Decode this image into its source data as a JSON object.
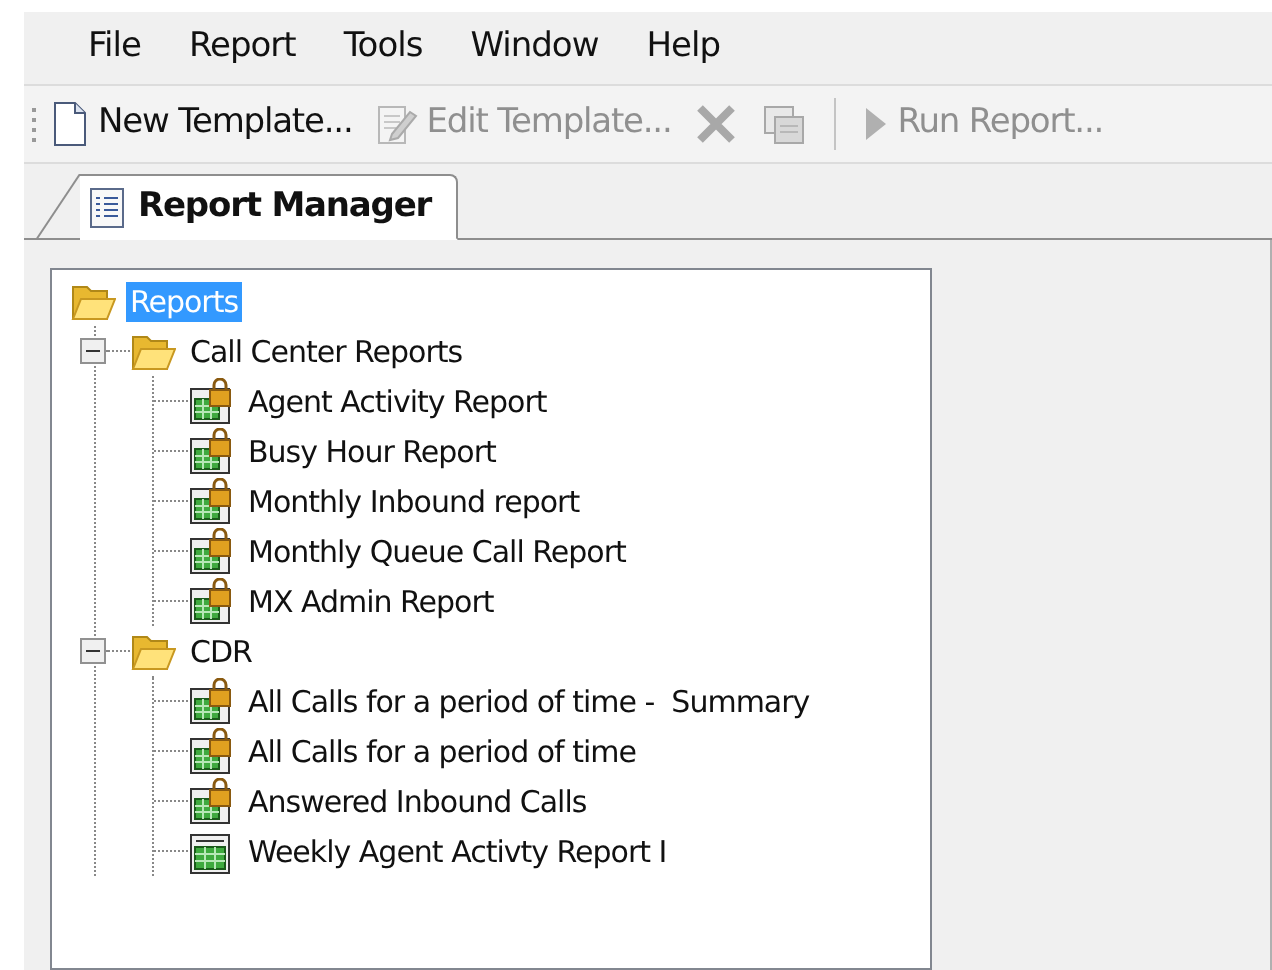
{
  "menu": [
    {
      "label": "File"
    },
    {
      "label": "Report"
    },
    {
      "label": "Tools"
    },
    {
      "label": "Window"
    },
    {
      "label": "Help"
    }
  ],
  "toolbar": [
    {
      "kind": "new",
      "label": "New Template...",
      "disabled": false
    },
    {
      "kind": "edit",
      "label": "Edit Template...",
      "disabled": true
    },
    {
      "kind": "delete",
      "disabled": true
    },
    {
      "kind": "copy",
      "disabled": true
    },
    {
      "kind": "separator"
    },
    {
      "kind": "run",
      "label": "Run Report...",
      "disabled": true
    }
  ],
  "tabs": [
    {
      "label": "Report Manager",
      "selected": true
    }
  ],
  "tree": [
    {
      "kind": "folder",
      "label": "Reports",
      "selected": true,
      "expanded": true,
      "children": [
        {
          "kind": "folder",
          "label": "Call Center Reports",
          "selected": false,
          "expanded": true,
          "children": [
            {
              "kind": "locked-report",
              "label": "Agent Activity Report",
              "selected": false
            },
            {
              "kind": "locked-report",
              "label": "Busy Hour Report",
              "selected": false
            },
            {
              "kind": "locked-report",
              "label": "Monthly Inbound report",
              "selected": false
            },
            {
              "kind": "locked-report",
              "label": "Monthly Queue Call Report",
              "selected": false
            },
            {
              "kind": "locked-report",
              "label": "MX Admin Report",
              "selected": false
            }
          ]
        },
        {
          "kind": "folder",
          "label": "CDR",
          "selected": false,
          "expanded": true,
          "children": [
            {
              "kind": "locked-report",
              "label": "All Calls for a period of time -  Summary",
              "selected": false
            },
            {
              "kind": "locked-report",
              "label": "All Calls for a period of time",
              "selected": false
            },
            {
              "kind": "locked-report",
              "label": "Answered Inbound Calls",
              "selected": false
            },
            {
              "kind": "report",
              "label": "Weekly Agent Activty Report I",
              "selected": false
            }
          ]
        }
      ]
    }
  ]
}
